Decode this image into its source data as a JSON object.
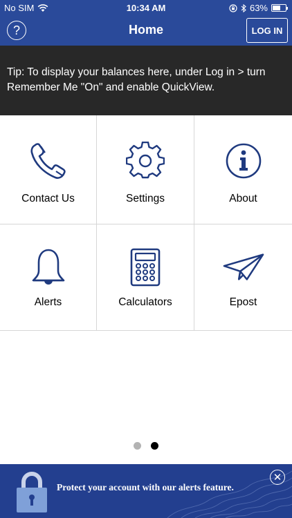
{
  "status_bar": {
    "carrier": "No SIM",
    "time": "10:34 AM",
    "battery": "63%",
    "battery_level": 0.63
  },
  "nav": {
    "title": "Home",
    "help_icon": "question-circle-icon",
    "help_glyph": "?",
    "login_label": "LOG IN"
  },
  "tip": {
    "text": "Tip: To display your balances here, under Log in > turn Remember Me \"On\" and enable QuickView."
  },
  "tiles": [
    {
      "label": "Contact Us",
      "icon": "phone-icon"
    },
    {
      "label": "Settings",
      "icon": "gear-icon"
    },
    {
      "label": "About",
      "icon": "info-icon"
    },
    {
      "label": "Alerts",
      "icon": "bell-icon"
    },
    {
      "label": "Calculators",
      "icon": "calculator-icon"
    },
    {
      "label": "Epost",
      "icon": "paper-plane-icon"
    }
  ],
  "pager": {
    "pages": 2,
    "current": 2
  },
  "banner": {
    "text": "Protect your account with our alerts feature.",
    "close_glyph": "✕",
    "icon": "padlock-icon"
  },
  "colors": {
    "brand_blue": "#2a4a9a",
    "icon_blue": "#1f3a7f",
    "tip_bg": "#282828",
    "banner_blue": "#233f8f"
  }
}
